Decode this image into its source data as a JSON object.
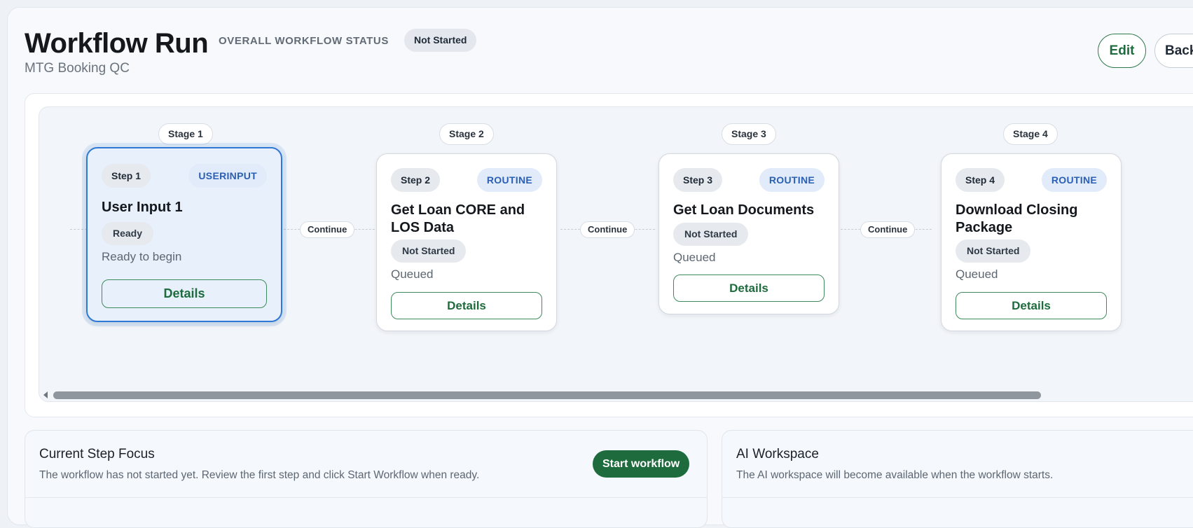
{
  "header": {
    "title": "Workflow Run",
    "overall_label": "OVERALL WORKFLOW STATUS",
    "overall_status": "Not Started",
    "subtitle": "MTG Booking QC",
    "edit_label": "Edit",
    "back_label": "Back"
  },
  "pipeline": {
    "connector_label": "Continue",
    "stages": [
      {
        "stage": "Stage 1",
        "step": "Step 1",
        "type": "USERINPUT",
        "title": "User Input 1",
        "status": "Ready",
        "status_text": "Ready to begin",
        "details": "Details"
      },
      {
        "stage": "Stage 2",
        "step": "Step 2",
        "type": "ROUTINE",
        "title": "Get Loan CORE and LOS Data",
        "status": "Not Started",
        "status_text": "Queued",
        "details": "Details"
      },
      {
        "stage": "Stage 3",
        "step": "Step 3",
        "type": "ROUTINE",
        "title": "Get Loan Documents",
        "status": "Not Started",
        "status_text": "Queued",
        "details": "Details"
      },
      {
        "stage": "Stage 4",
        "step": "Step 4",
        "type": "ROUTINE",
        "title": "Download Closing Package",
        "status": "Not Started",
        "status_text": "Queued",
        "details": "Details"
      }
    ]
  },
  "current_step": {
    "title": "Current Step Focus",
    "description": "The workflow has not started yet. Review the first step and click Start Workflow when ready.",
    "start_label": "Start workflow"
  },
  "ai_workspace": {
    "title": "AI Workspace",
    "description": "The AI workspace will become available when the workflow starts."
  }
}
